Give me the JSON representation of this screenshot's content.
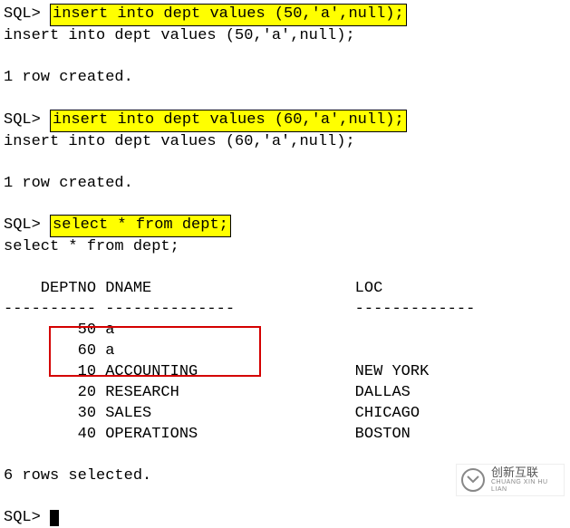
{
  "prompt": "SQL>",
  "cmd1": "insert into dept values (50,'a',null);",
  "echo1": "insert into dept values (50,'a',null);",
  "result1": "1 row created.",
  "cmd2": "insert into dept values (60,'a',null);",
  "echo2": "insert into dept values (60,'a',null);",
  "result2": "1 row created.",
  "cmd3": "select * from dept;",
  "echo3": "select * from dept;",
  "headers": {
    "deptno": "DEPTNO",
    "dname": "DNAME",
    "loc": "LOC"
  },
  "dashes": {
    "deptno": "----------",
    "dname": "--------------",
    "loc": "-------------"
  },
  "rows": [
    {
      "deptno": "50",
      "dname": "a",
      "loc": ""
    },
    {
      "deptno": "60",
      "dname": "a",
      "loc": ""
    },
    {
      "deptno": "10",
      "dname": "ACCOUNTING",
      "loc": "NEW YORK"
    },
    {
      "deptno": "20",
      "dname": "RESEARCH",
      "loc": "DALLAS"
    },
    {
      "deptno": "30",
      "dname": "SALES",
      "loc": "CHICAGO"
    },
    {
      "deptno": "40",
      "dname": "OPERATIONS",
      "loc": "BOSTON"
    }
  ],
  "footer": "6 rows selected.",
  "watermark": {
    "brand": "创新互联",
    "sub": "CHUANG XIN HU LIAN"
  }
}
